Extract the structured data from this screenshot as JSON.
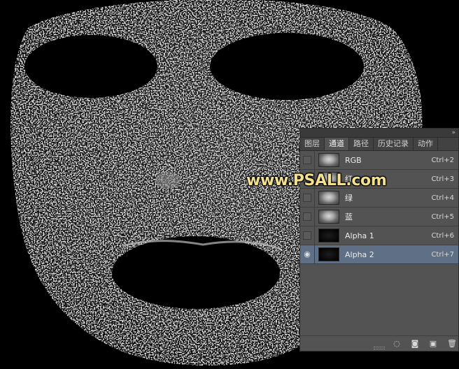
{
  "tabs": [
    {
      "label": "图层",
      "active": false
    },
    {
      "label": "通道",
      "active": true
    },
    {
      "label": "路径",
      "active": false
    },
    {
      "label": "历史记录",
      "active": false
    },
    {
      "label": "动作",
      "active": false
    }
  ],
  "channels": [
    {
      "label": "RGB",
      "shortcut": "Ctrl+2",
      "thumb": "face",
      "visible": false,
      "selected": false
    },
    {
      "label": "红",
      "shortcut": "Ctrl+3",
      "thumb": "face",
      "visible": false,
      "selected": false
    },
    {
      "label": "绿",
      "shortcut": "Ctrl+4",
      "thumb": "face",
      "visible": false,
      "selected": false
    },
    {
      "label": "蓝",
      "shortcut": "Ctrl+5",
      "thumb": "face",
      "visible": false,
      "selected": false
    },
    {
      "label": "Alpha 1",
      "shortcut": "Ctrl+6",
      "thumb": "dark",
      "visible": false,
      "selected": false
    },
    {
      "label": "Alpha 2",
      "shortcut": "Ctrl+7",
      "thumb": "dark",
      "visible": true,
      "selected": true
    }
  ],
  "watermark": "www.PSALL.com",
  "icons": {
    "collapse": "double-chevron-right-icon",
    "eye": "eye-icon",
    "load_selection": "dotted-circle-icon",
    "save_selection": "mask-icon",
    "new_channel": "new-channel-icon",
    "delete_channel": "trash-icon"
  },
  "colors": {
    "panel_bg": "#535353",
    "selected_row": "#5f6f86",
    "watermark": "#f3e08a"
  }
}
